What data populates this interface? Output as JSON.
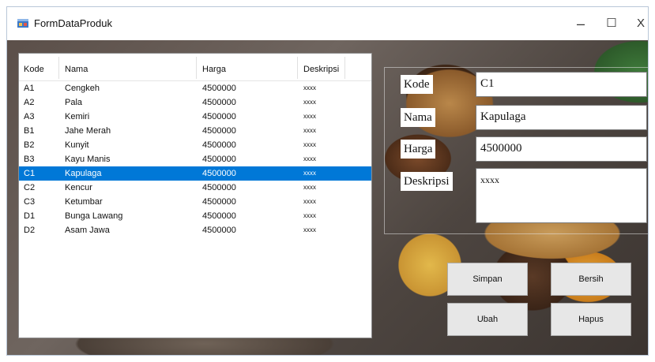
{
  "window": {
    "title": "FormDataProduk",
    "controls": {
      "minimize": "–",
      "maximize": "☐",
      "close": "X"
    }
  },
  "table": {
    "columns": [
      "Kode",
      "Nama",
      "Harga",
      "Deskripsi"
    ],
    "rows": [
      {
        "kode": "A1",
        "nama": "Cengkeh",
        "harga": "4500000",
        "deskripsi": "xxxx"
      },
      {
        "kode": "A2",
        "nama": "Pala",
        "harga": "4500000",
        "deskripsi": "xxxx"
      },
      {
        "kode": "A3",
        "nama": "Kemiri",
        "harga": "4500000",
        "deskripsi": "xxxx"
      },
      {
        "kode": "B1",
        "nama": "Jahe Merah",
        "harga": "4500000",
        "deskripsi": "xxxx"
      },
      {
        "kode": "B2",
        "nama": "Kunyit",
        "harga": "4500000",
        "deskripsi": "xxxx"
      },
      {
        "kode": "B3",
        "nama": "Kayu Manis",
        "harga": "4500000",
        "deskripsi": "xxxx"
      },
      {
        "kode": "C1",
        "nama": "Kapulaga",
        "harga": "4500000",
        "deskripsi": "xxxx"
      },
      {
        "kode": "C2",
        "nama": "Kencur",
        "harga": "4500000",
        "deskripsi": "xxxx"
      },
      {
        "kode": "C3",
        "nama": "Ketumbar",
        "harga": "4500000",
        "deskripsi": "xxxx"
      },
      {
        "kode": "D1",
        "nama": "Bunga Lawang",
        "harga": "4500000",
        "deskripsi": "xxxx"
      },
      {
        "kode": "D2",
        "nama": "Asam Jawa",
        "harga": "4500000",
        "deskripsi": "xxxx"
      }
    ],
    "selected_index": 6
  },
  "form": {
    "kode_label": "Kode",
    "kode_value": "C1",
    "nama_label": "Nama",
    "nama_value": "Kapulaga",
    "harga_label": "Harga",
    "harga_value": "4500000",
    "deskripsi_label": "Deskripsi",
    "deskripsi_value": "xxxx"
  },
  "buttons": {
    "simpan": "Simpan",
    "bersih": "Bersih",
    "ubah": "Ubah",
    "hapus": "Hapus"
  },
  "colors": {
    "selection": "#0078d7",
    "button_face": "#e7e7e7"
  }
}
